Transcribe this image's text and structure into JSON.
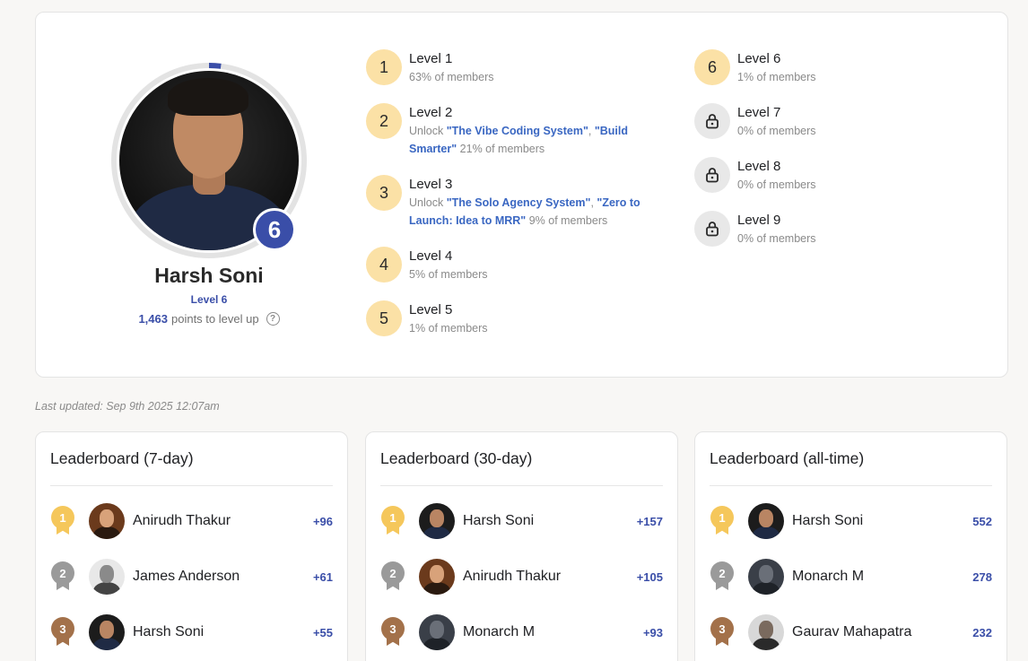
{
  "profile": {
    "name": "Harsh Soni",
    "level_number": "6",
    "level_label": "Level 6",
    "points": "1,463",
    "points_suffix": "points to level up",
    "progress": 0.02
  },
  "levels": [
    {
      "num": "1",
      "title": "Level 1",
      "pre": "",
      "unlock": [],
      "members": "63% of members",
      "locked": false
    },
    {
      "num": "2",
      "title": "Level 2",
      "pre": "Unlock ",
      "unlock": [
        "\"The Vibe Coding System\"",
        "\"Build Smarter\""
      ],
      "members": " 21% of members",
      "locked": false
    },
    {
      "num": "3",
      "title": "Level 3",
      "pre": "Unlock ",
      "unlock": [
        "\"The Solo Agency System\"",
        "\"Zero to Launch: Idea to MRR\""
      ],
      "members": " 9% of members",
      "locked": false
    },
    {
      "num": "4",
      "title": "Level 4",
      "pre": "",
      "unlock": [],
      "members": "5% of members",
      "locked": false
    },
    {
      "num": "5",
      "title": "Level 5",
      "pre": "",
      "unlock": [],
      "members": "1% of members",
      "locked": false
    },
    {
      "num": "6",
      "title": "Level 6",
      "pre": "",
      "unlock": [],
      "members": "1% of members",
      "locked": false
    },
    {
      "num": "",
      "title": "Level 7",
      "pre": "",
      "unlock": [],
      "members": "0% of members",
      "locked": true
    },
    {
      "num": "",
      "title": "Level 8",
      "pre": "",
      "unlock": [],
      "members": "0% of members",
      "locked": true
    },
    {
      "num": "",
      "title": "Level 9",
      "pre": "",
      "unlock": [],
      "members": "0% of members",
      "locked": true
    }
  ],
  "last_updated": "Last updated: Sep 9th 2025 12:07am",
  "leaderboards": [
    {
      "title": "Leaderboard (7-day)",
      "rows": [
        {
          "rank": "1",
          "name": "Anirudh Thakur",
          "points": "+96",
          "avatar": "anirudh"
        },
        {
          "rank": "2",
          "name": "James Anderson",
          "points": "+61",
          "avatar": "james"
        },
        {
          "rank": "3",
          "name": "Harsh Soni",
          "points": "+55",
          "avatar": "harsh"
        }
      ]
    },
    {
      "title": "Leaderboard (30-day)",
      "rows": [
        {
          "rank": "1",
          "name": "Harsh Soni",
          "points": "+157",
          "avatar": "harsh"
        },
        {
          "rank": "2",
          "name": "Anirudh Thakur",
          "points": "+105",
          "avatar": "anirudh"
        },
        {
          "rank": "3",
          "name": "Monarch M",
          "points": "+93",
          "avatar": "monarch"
        }
      ]
    },
    {
      "title": "Leaderboard (all-time)",
      "rows": [
        {
          "rank": "1",
          "name": "Harsh Soni",
          "points": "552",
          "avatar": "harsh"
        },
        {
          "rank": "2",
          "name": "Monarch M",
          "points": "278",
          "avatar": "monarch"
        },
        {
          "rank": "3",
          "name": "Gaurav Mahapatra",
          "points": "232",
          "avatar": "gaurav"
        }
      ]
    }
  ],
  "colors": {
    "accent": "#3a4ea8",
    "link": "#3a67c2",
    "level_bg": "#fbe1a6",
    "locked_bg": "#e8e8e8"
  },
  "icons": {
    "locked": "lock-icon",
    "help": "help-circle-icon"
  }
}
